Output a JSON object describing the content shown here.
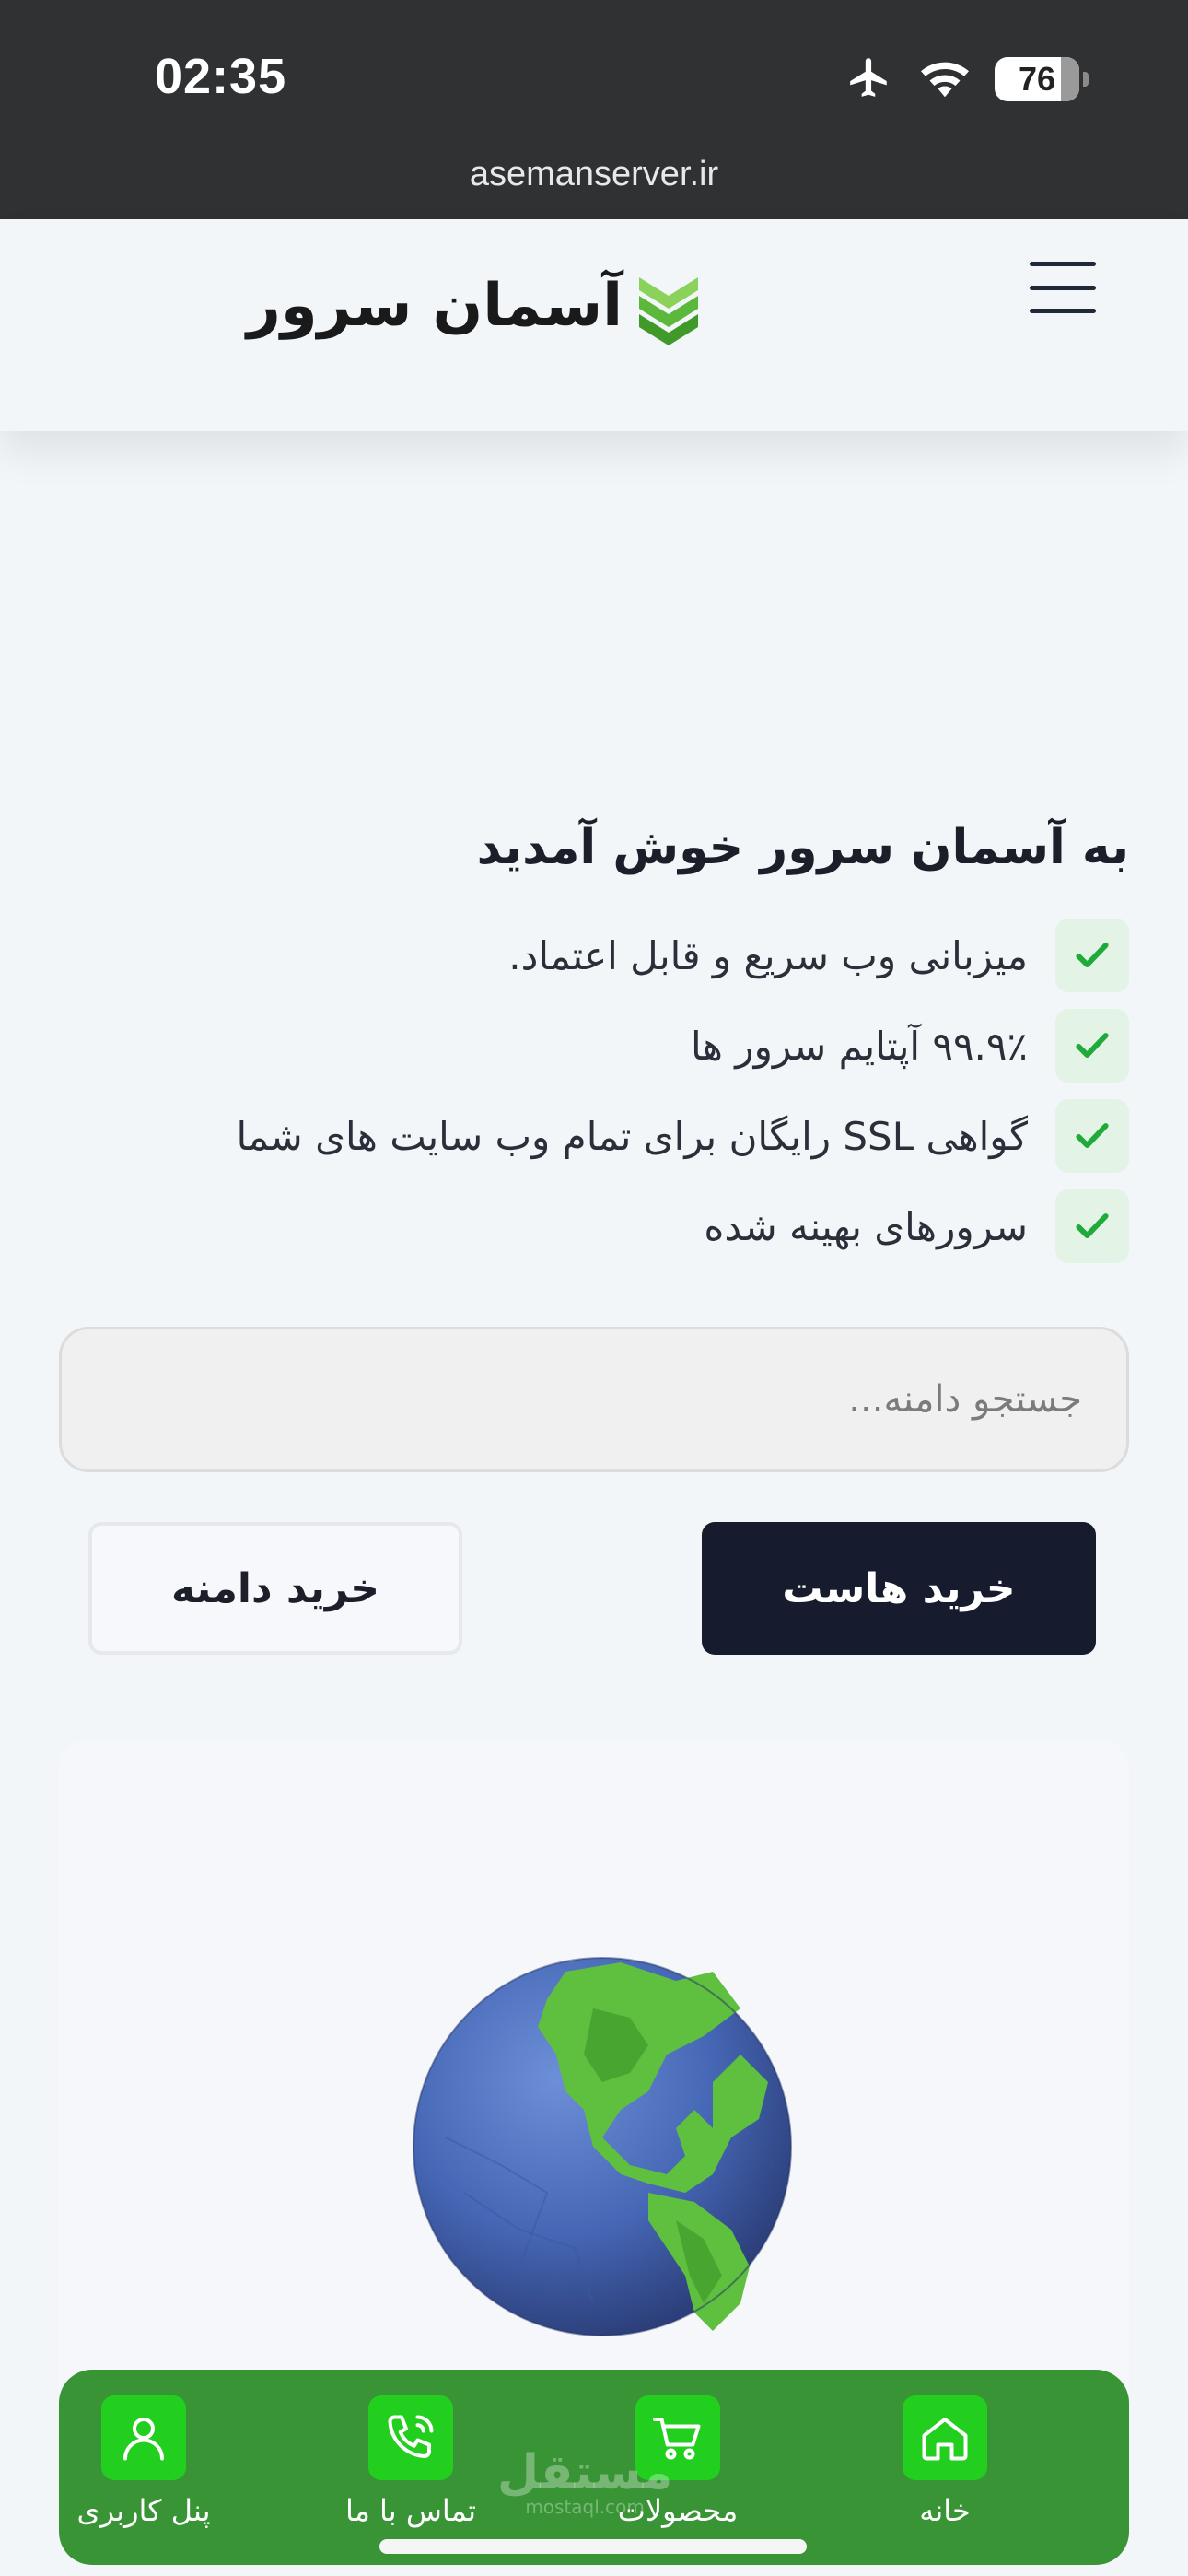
{
  "status_bar": {
    "time": "02:35",
    "battery": "76",
    "icons": [
      "airplane-icon",
      "wifi-icon",
      "battery-icon"
    ]
  },
  "browser": {
    "url": "asemanserver.ir"
  },
  "header": {
    "logo_text": "آسمان سرور",
    "logo_icon": "chevrons-logo-icon",
    "menu_icon": "hamburger-menu-icon",
    "brand_color": "#5cb83a"
  },
  "hero": {
    "title": "به آسمان سرور خوش آمدید",
    "features": [
      "میزبانی وب سریع و قابل اعتماد.",
      "۹۹.۹٪ آپتایم سرور ها",
      "گواهی SSL رایگان برای تمام وب سایت های شما",
      "سرورهای بهینه شده"
    ],
    "check_color": "#1faa3a"
  },
  "search": {
    "placeholder": "جستجو دامنه...",
    "value": ""
  },
  "buttons": {
    "buy_host": "خرید هاست",
    "buy_domain": "خرید دامنه"
  },
  "bottom_nav": {
    "items": [
      {
        "label": "خانه",
        "icon": "home-icon"
      },
      {
        "label": "محصولات",
        "icon": "cart-icon"
      },
      {
        "label": "تماس با ما",
        "icon": "phone-icon"
      },
      {
        "label": "پنل کاربری",
        "icon": "user-icon"
      }
    ],
    "bar_color": "#389435",
    "icon_bg": "#22cf1f"
  },
  "watermark": {
    "ar": "مستقل",
    "en": "mostaql.com"
  }
}
